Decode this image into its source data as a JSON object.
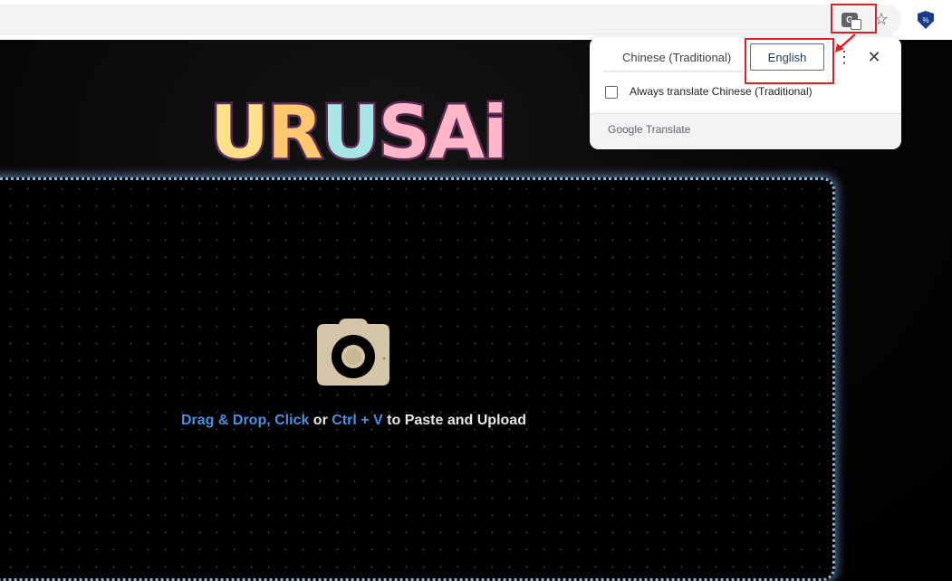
{
  "browser": {
    "translate_icon": "translate-icon",
    "star_icon": "star-icon",
    "extension_icon": "shield-icon",
    "highlight_color": "#e02020"
  },
  "page": {
    "logo_letters": [
      {
        "char": "U",
        "color": "#ffe08a"
      },
      {
        "char": "R",
        "color": "#ffc870"
      },
      {
        "char": "U",
        "color": "#a8e6e6"
      },
      {
        "char": "S",
        "color": "#ffb6c8"
      },
      {
        "char": "A",
        "color": "#ffb6c8"
      },
      {
        "char": "i",
        "color": "#ffb6c8"
      }
    ],
    "upload": {
      "part1": "Drag & Drop, Click",
      "part2": " or ",
      "part3": "Ctrl + V",
      "part4": " to Paste and Upload",
      "accent_color": "#4a90e2"
    },
    "camera_icon": "camera-icon"
  },
  "translate_popup": {
    "source_language": "Chinese (Traditional)",
    "target_language": "English",
    "always_translate_label": "Always translate Chinese (Traditional)",
    "always_translate_checked": false,
    "brand_google": "Google",
    "brand_translate": " Translate",
    "more_icon": "more-vertical-icon",
    "close_icon": "close-icon"
  }
}
